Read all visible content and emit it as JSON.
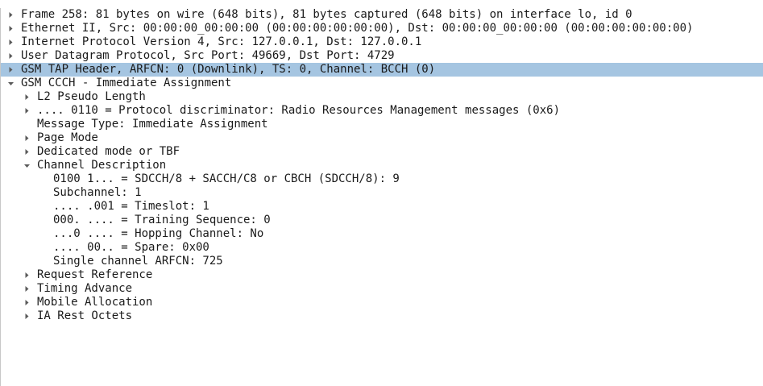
{
  "tree": [
    {
      "label": "Frame 258: 81 bytes on wire (648 bits), 81 bytes captured (648 bits) on interface lo, id 0",
      "level": 0,
      "state": "collapsed"
    },
    {
      "label": "Ethernet II, Src: 00:00:00_00:00:00 (00:00:00:00:00:00), Dst: 00:00:00_00:00:00 (00:00:00:00:00:00)",
      "level": 0,
      "state": "collapsed"
    },
    {
      "label": "Internet Protocol Version 4, Src: 127.0.0.1, Dst: 127.0.0.1",
      "level": 0,
      "state": "collapsed"
    },
    {
      "label": "User Datagram Protocol, Src Port: 49669, Dst Port: 4729",
      "level": 0,
      "state": "collapsed"
    },
    {
      "label": "GSM TAP Header, ARFCN: 0 (Downlink), TS: 0, Channel: BCCH (0)",
      "level": 0,
      "state": "collapsed",
      "selected": true
    },
    {
      "label": "GSM CCCH - Immediate Assignment",
      "level": 0,
      "state": "expanded"
    },
    {
      "label": "L2 Pseudo Length",
      "level": 1,
      "state": "collapsed"
    },
    {
      "label": ".... 0110 = Protocol discriminator: Radio Resources Management messages (0x6)",
      "level": 1,
      "state": "collapsed"
    },
    {
      "label": "Message Type: Immediate Assignment",
      "level": 1,
      "state": "leaf"
    },
    {
      "label": "Page Mode",
      "level": 1,
      "state": "collapsed"
    },
    {
      "label": "Dedicated mode or TBF",
      "level": 1,
      "state": "collapsed"
    },
    {
      "label": "Channel Description",
      "level": 1,
      "state": "expanded"
    },
    {
      "label": "0100 1... = SDCCH/8 + SACCH/C8 or CBCH (SDCCH/8): 9",
      "level": 2,
      "state": "leaf"
    },
    {
      "label": "Subchannel: 1",
      "level": 2,
      "state": "leaf"
    },
    {
      "label": ".... .001 = Timeslot: 1",
      "level": 2,
      "state": "leaf"
    },
    {
      "label": "000. .... = Training Sequence: 0",
      "level": 2,
      "state": "leaf"
    },
    {
      "label": "...0 .... = Hopping Channel: No",
      "level": 2,
      "state": "leaf"
    },
    {
      "label": ".... 00.. = Spare: 0x00",
      "level": 2,
      "state": "leaf"
    },
    {
      "label": "Single channel ARFCN: 725",
      "level": 2,
      "state": "leaf"
    },
    {
      "label": "Request Reference",
      "level": 1,
      "state": "collapsed"
    },
    {
      "label": "Timing Advance",
      "level": 1,
      "state": "collapsed"
    },
    {
      "label": "Mobile Allocation",
      "level": 1,
      "state": "collapsed"
    },
    {
      "label": "IA Rest Octets",
      "level": 1,
      "state": "collapsed"
    }
  ]
}
